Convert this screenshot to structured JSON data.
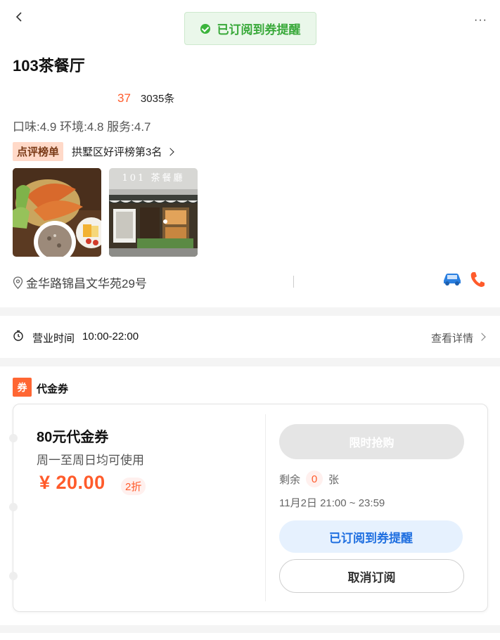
{
  "toast": {
    "text": "已订阅到券提醒",
    "icon": "check-circle-icon"
  },
  "header": {
    "back_icon": "chevron-left-icon",
    "more_label": "···"
  },
  "shop": {
    "name": "103茶餐厅",
    "score": "37",
    "review_count": "3035条",
    "subscores": "口味:4.9 环境:4.8 服务:4.7",
    "rank_badge": "点评榜单",
    "rank_text": "拱墅区好评榜第3名",
    "address": "金华路锦昌文华苑29号",
    "storefront_sign": "101 茶餐廳"
  },
  "hours": {
    "label": "营业时间",
    "time": "10:00-22:00",
    "detail": "查看详情"
  },
  "coupon_section": {
    "tag": "券",
    "title": "代金券",
    "card": {
      "name": "80元代金券",
      "usage": "周一至周日均可使用",
      "price": "¥ 20.00",
      "discount": "2折",
      "limited_label": "限时抢购",
      "remain_prefix": "剩余",
      "remain_count": "0",
      "remain_suffix": "张",
      "date": "11月2日 21:00 ~ 23:59",
      "subscribed_label": "已订阅到券提醒",
      "cancel_label": "取消订阅"
    }
  },
  "colors": {
    "accent_orange": "#ff5b2b",
    "toast_green": "#39a93a",
    "subscribe_blue": "#1f6fe0",
    "car_blue": "#2a7fe0"
  }
}
